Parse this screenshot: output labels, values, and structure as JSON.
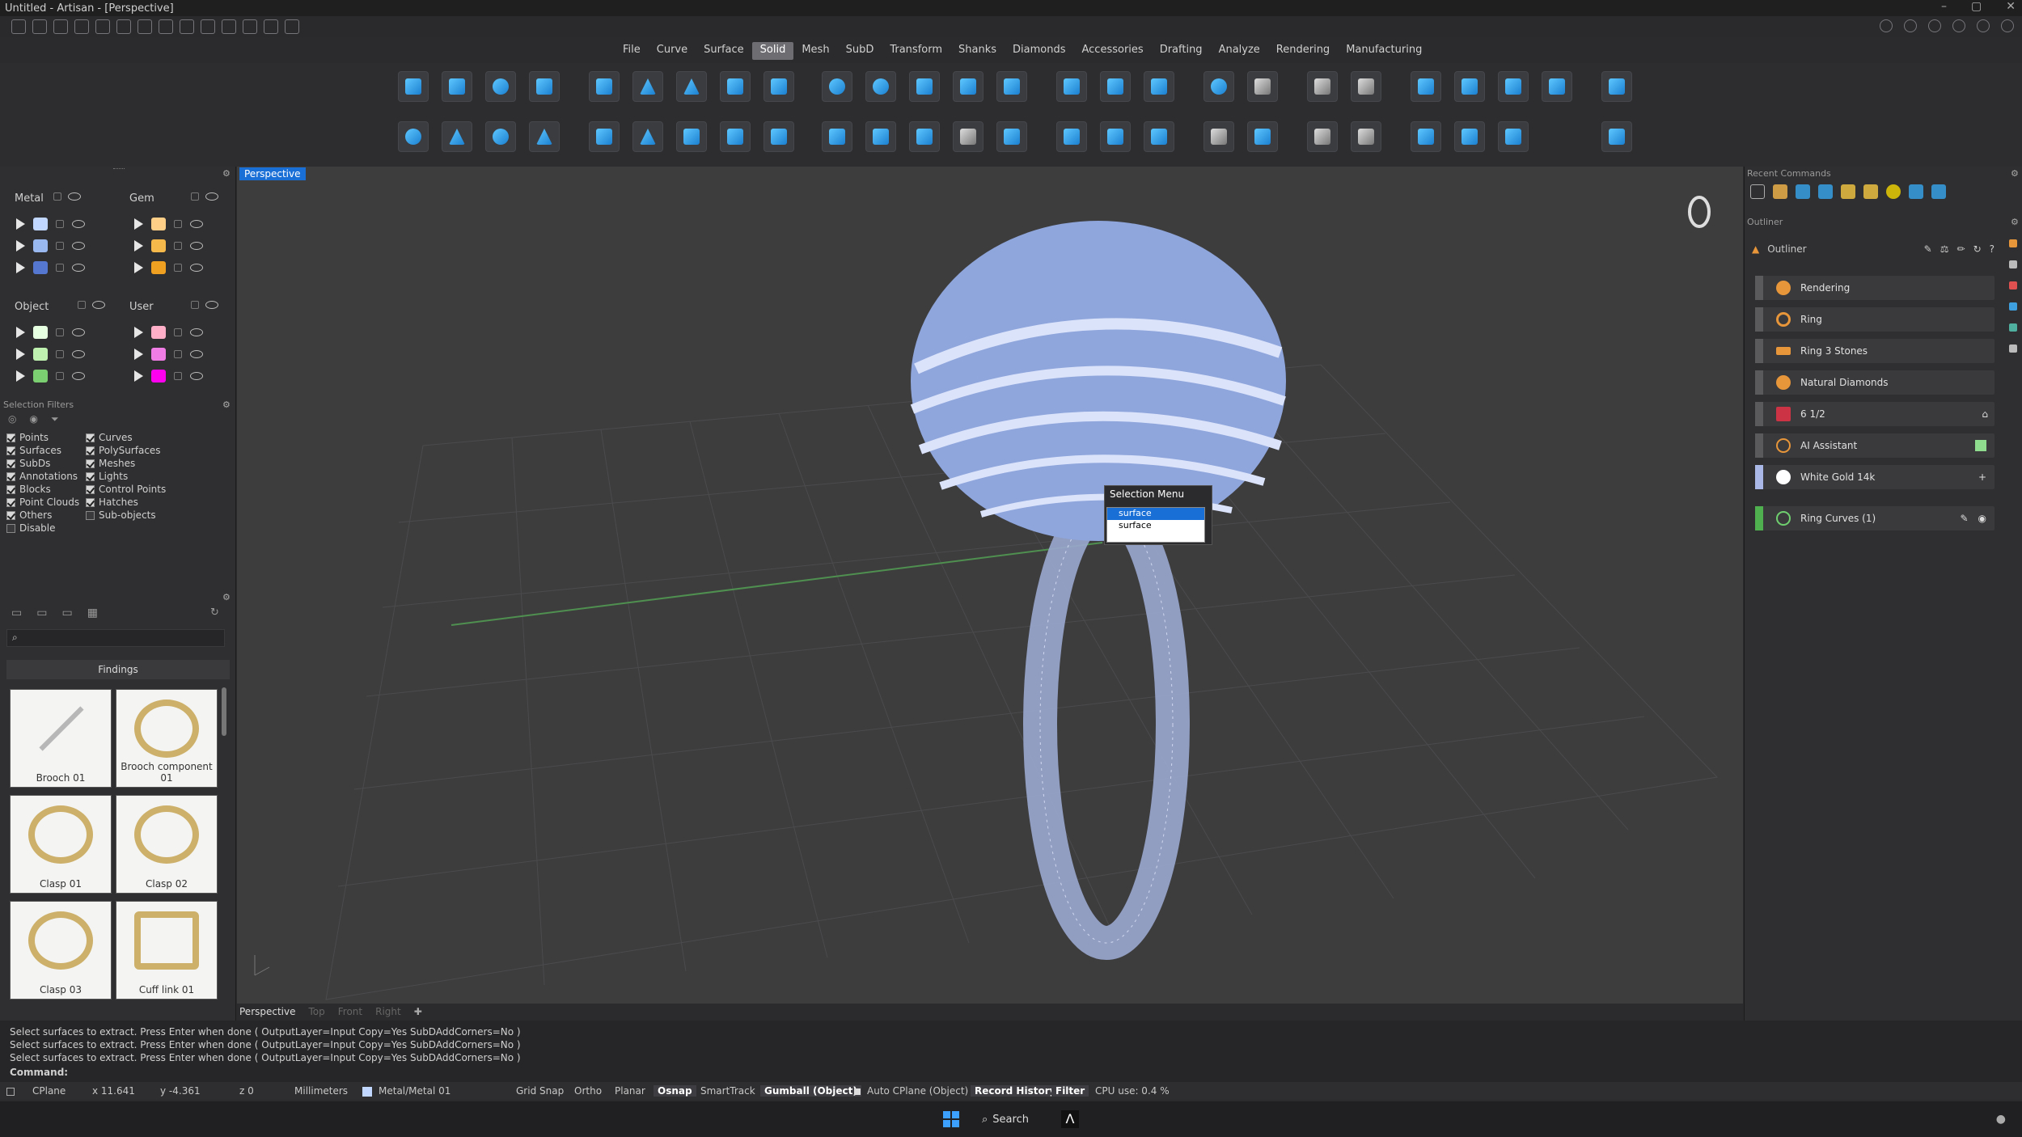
{
  "window": {
    "title": "Untitled - Artisan - [Perspective]"
  },
  "menu": [
    "File",
    "Curve",
    "Surface",
    "Solid",
    "Mesh",
    "SubD",
    "Transform",
    "Shanks",
    "Diamonds",
    "Accessories",
    "Drafting",
    "Analyze",
    "Rendering",
    "Manufacturing"
  ],
  "menu_active": "Solid",
  "layers": {
    "metal": {
      "label": "Metal",
      "colors": [
        "#c2d7ff",
        "#9ab8f0",
        "#5577d0"
      ]
    },
    "gem": {
      "label": "Gem",
      "colors": [
        "#ffcf88",
        "#f5b84a",
        "#f0a020"
      ]
    },
    "object": {
      "label": "Object",
      "colors": [
        "#e5ffe0",
        "#bff2b0",
        "#7ccf70"
      ]
    },
    "user": {
      "label": "User",
      "colors": [
        "#ffb0c8",
        "#f07ce6",
        "#ff00ee"
      ]
    }
  },
  "selection_filters": {
    "title": "Selection Filters",
    "left": [
      {
        "label": "Points",
        "on": true
      },
      {
        "label": "Surfaces",
        "on": true
      },
      {
        "label": "SubDs",
        "on": true
      },
      {
        "label": "Annotations",
        "on": true
      },
      {
        "label": "Blocks",
        "on": true
      },
      {
        "label": "Point Clouds",
        "on": true
      },
      {
        "label": "Others",
        "on": true
      },
      {
        "label": "Disable",
        "on": false
      }
    ],
    "right": [
      {
        "label": "Curves",
        "on": true
      },
      {
        "label": "PolySurfaces",
        "on": true
      },
      {
        "label": "Meshes",
        "on": true
      },
      {
        "label": "Lights",
        "on": true
      },
      {
        "label": "Control Points",
        "on": true
      },
      {
        "label": "Hatches",
        "on": true
      },
      {
        "label": "Sub-objects",
        "on": false
      }
    ]
  },
  "library": {
    "section": "Findings",
    "items": [
      "Brooch 01",
      "Brooch component 01",
      "Clasp 01",
      "Clasp 02",
      "Clasp 03",
      "Cuff link 01"
    ]
  },
  "viewport": {
    "tab": "Perspective",
    "bottom_tabs": [
      "Perspective",
      "Top",
      "Front",
      "Right"
    ]
  },
  "selection_menu": {
    "title": "Selection Menu",
    "items": [
      "surface",
      "surface"
    ]
  },
  "right": {
    "recent_title": "Recent Commands",
    "outliner_section": "Outliner",
    "outliner_label": "Outliner",
    "rows": [
      {
        "label": "Rendering",
        "icon": "#e8963a"
      },
      {
        "label": "Ring",
        "icon": "#e8963a"
      },
      {
        "label": "Ring 3 Stones",
        "icon": "#e8963a"
      },
      {
        "label": "Natural Diamonds",
        "icon": "#e8963a"
      },
      {
        "label": "6 1/2",
        "icon": "#cc3344"
      },
      {
        "label": "AI Assistant",
        "icon": "#e8963a"
      },
      {
        "label": "White Gold 14k",
        "icon": "#ffffff"
      }
    ],
    "curves_row": "Ring Curves (1)"
  },
  "command": {
    "lines": [
      "Select surfaces to extract. Press Enter when done ( OutputLayer=Input  Copy=Yes  SubDAddCorners=No )",
      "Select surfaces to extract. Press Enter when done ( OutputLayer=Input  Copy=Yes  SubDAddCorners=No )",
      "Select surfaces to extract. Press Enter when done ( OutputLayer=Input  Copy=Yes  SubDAddCorners=No )"
    ],
    "prompt": "Command:"
  },
  "status": {
    "cplane": "CPlane",
    "x": "x 11.641",
    "y": "y -4.361",
    "z": "z 0",
    "units": "Millimeters",
    "layer": "Metal/Metal 01",
    "grid_snap": "Grid Snap",
    "ortho": "Ortho",
    "planar": "Planar",
    "osnap": "Osnap",
    "smarttrack": "SmartTrack",
    "gumball": "Gumball (Object)",
    "auto_cplane": "Auto CPlane (Object)",
    "record_history": "Record History",
    "filter": "Filter",
    "cpu": "CPU use: 0.4 %"
  },
  "taskbar": {
    "search": "Search"
  }
}
